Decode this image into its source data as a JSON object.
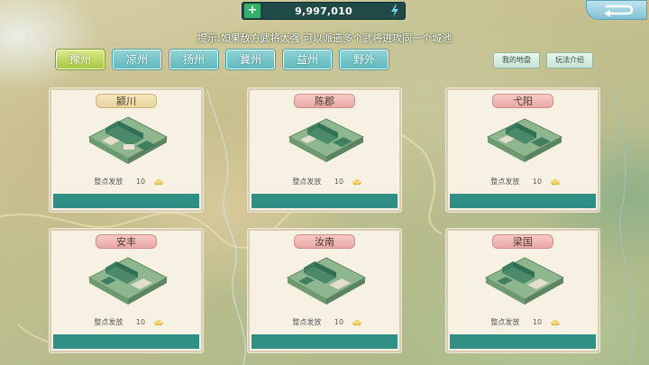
{
  "currency": {
    "amount": "9,997,010",
    "plus_icon": "plus-icon",
    "energy_icon": "lightning-icon",
    "color": "#1f4a48"
  },
  "back_button": {
    "icon": "back-arrow-icon"
  },
  "hint": "提示:如果敌方武将太强 可以派遣多个武将进攻同一个城池",
  "tabs": [
    {
      "label": "豫州",
      "active": true
    },
    {
      "label": "凉州",
      "active": false
    },
    {
      "label": "扬州",
      "active": false
    },
    {
      "label": "冀州",
      "active": false
    },
    {
      "label": "益州",
      "active": false
    },
    {
      "label": "野外",
      "active": false
    }
  ],
  "buttons": {
    "my_territory": "我的地盘",
    "rules": "玩法介绍"
  },
  "cities": [
    {
      "name": "颍川",
      "style": "gold",
      "reward_label": "整点发放",
      "reward_amount": "10",
      "reward_icon": "gold-ingot-icon"
    },
    {
      "name": "陈郡",
      "style": "pink",
      "reward_label": "整点发放",
      "reward_amount": "10",
      "reward_icon": "gold-ingot-icon"
    },
    {
      "name": "弋阳",
      "style": "pink",
      "reward_label": "整点发放",
      "reward_amount": "10",
      "reward_icon": "gold-ingot-icon"
    },
    {
      "name": "安丰",
      "style": "pink",
      "reward_label": "整点发放",
      "reward_amount": "10",
      "reward_icon": "gold-ingot-icon"
    },
    {
      "name": "汝南",
      "style": "pink",
      "reward_label": "整点发放",
      "reward_amount": "10",
      "reward_icon": "gold-ingot-icon"
    },
    {
      "name": "梁国",
      "style": "pink",
      "reward_label": "整点发放",
      "reward_amount": "10",
      "reward_icon": "gold-ingot-icon"
    }
  ],
  "colors": {
    "tab": "#5fb9be",
    "tab_active": "#a9c746",
    "card_bar": "#2f8f84"
  }
}
